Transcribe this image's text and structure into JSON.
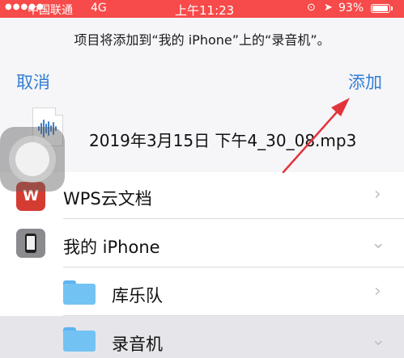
{
  "status_bar": {
    "signal": "●●●●●",
    "carrier": "中国联通",
    "network": "4G",
    "time": "上午11:23",
    "battery_percent": "93%",
    "battery_level": 0.93
  },
  "dialog": {
    "message": "项目将添加到“我的 iPhone”上的“录音机”。",
    "cancel_label": "取消",
    "add_label": "添加",
    "filename": "2019年3月15日 下午4_30_08.mp3"
  },
  "locations": [
    {
      "label": "WPS云文档",
      "icon": "wps-icon",
      "icon_text": "W",
      "chevron": "›"
    },
    {
      "label": "我的 iPhone",
      "icon": "iphone-icon",
      "chevron": "⌄"
    },
    {
      "label": "库乐队",
      "icon": "folder-icon",
      "chevron": "›"
    },
    {
      "label": "录音机",
      "icon": "folder-icon",
      "chevron": "⌄"
    }
  ],
  "colors": {
    "status_bar": "#f74a4a",
    "accent": "#2f7fd4",
    "annotation_arrow": "#e0353a",
    "wps": "#d43c32",
    "folder": "#72c3f4"
  }
}
